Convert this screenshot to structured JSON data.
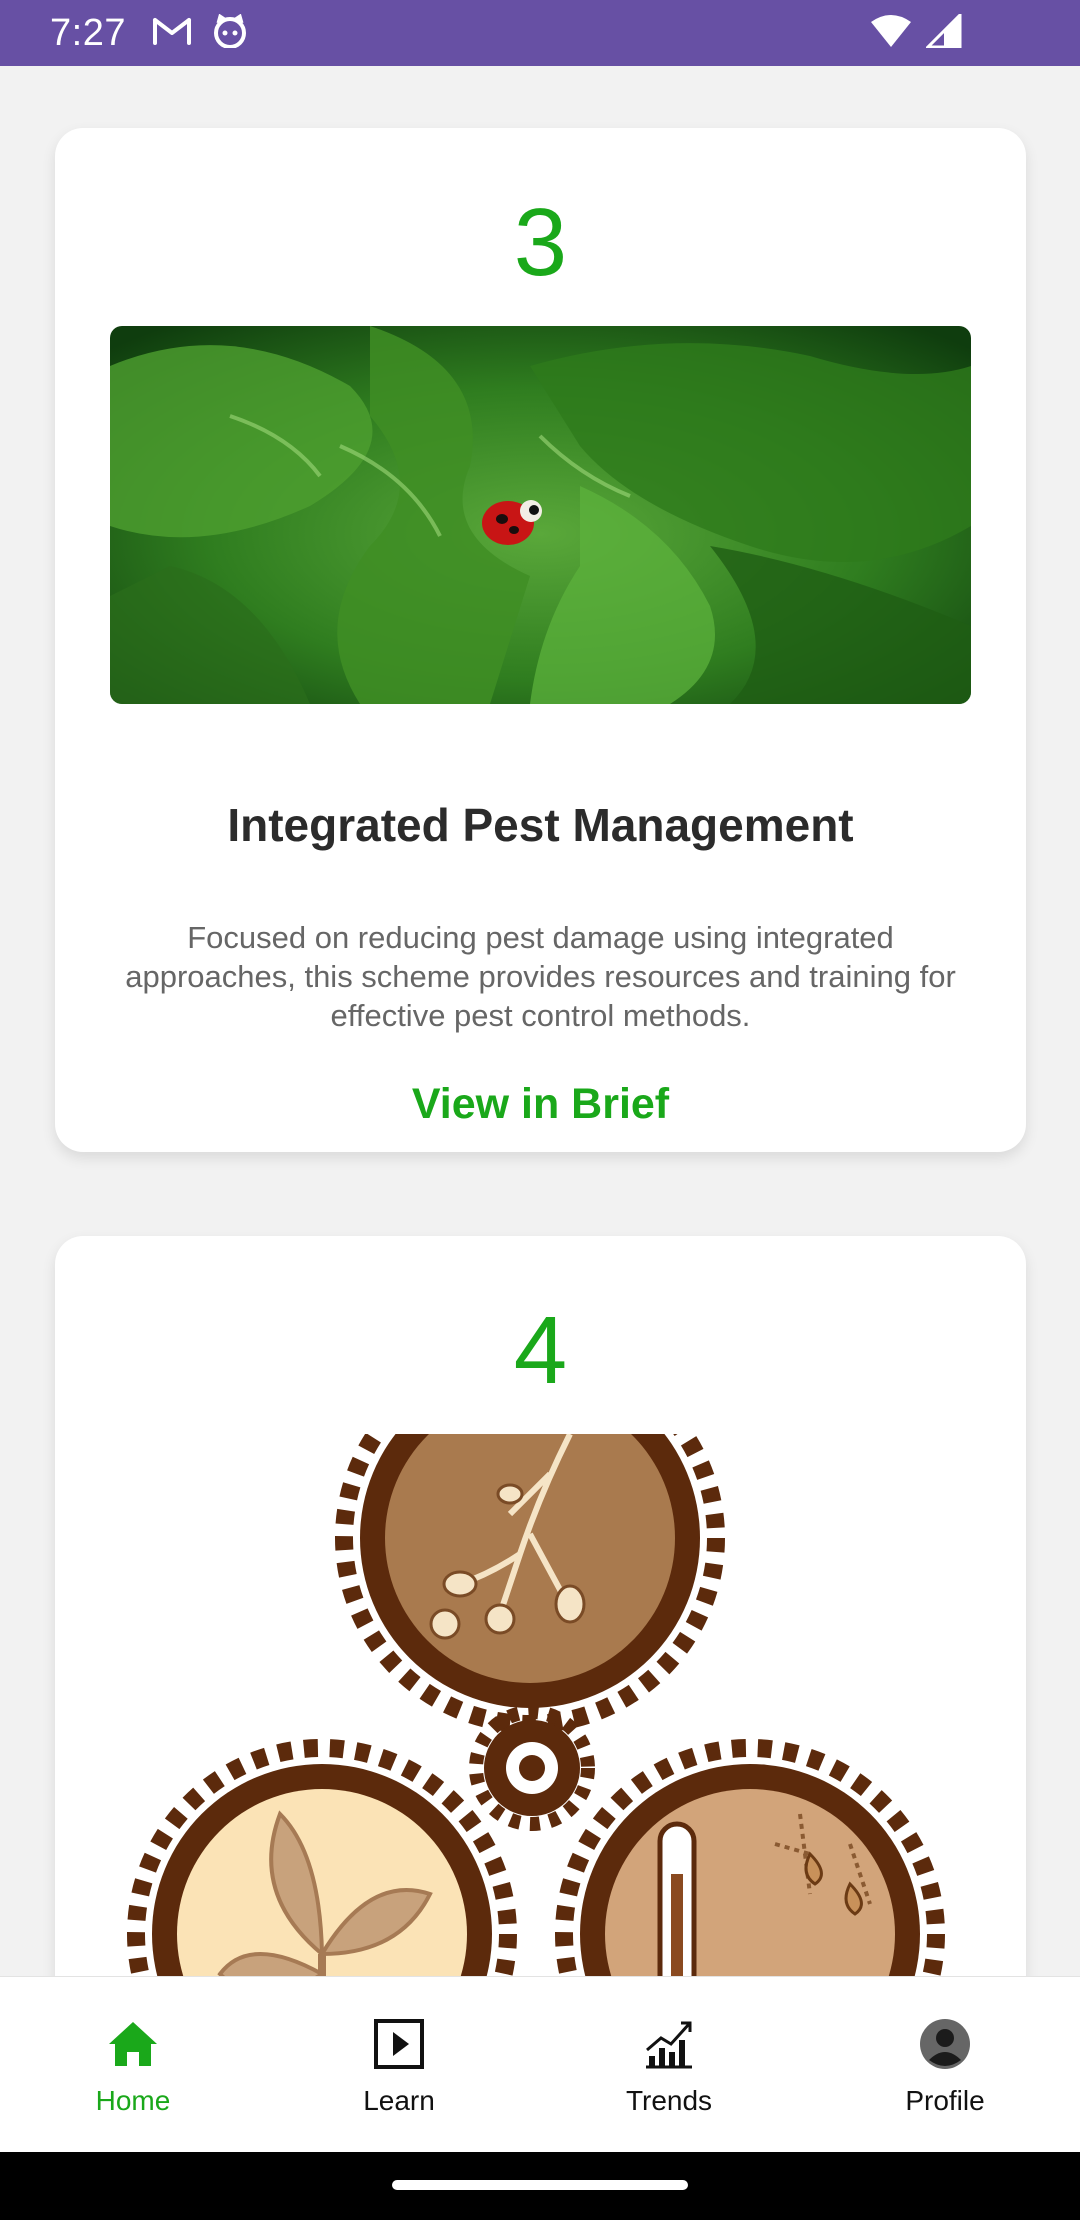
{
  "status_bar": {
    "time": "7:27",
    "icons": [
      "gmail-icon",
      "cat-face-icon",
      "wifi-icon",
      "signal-icon"
    ],
    "color": "#6750a4"
  },
  "cards": [
    {
      "number": "3",
      "image": "ladybug-on-lettuce-image",
      "title": "Integrated Pest Management",
      "description": "Focused on reducing pest damage using integrated approaches, this scheme provides resources and training for effective pest control methods.",
      "link_label": "View in Brief"
    },
    {
      "number": "4",
      "image": "soil-plant-weather-gears-image"
    }
  ],
  "accent_color": "#1aa81a",
  "bottom_nav": {
    "items": [
      {
        "label": "Home",
        "icon": "home-icon",
        "active": true
      },
      {
        "label": "Learn",
        "icon": "play-icon",
        "active": false
      },
      {
        "label": "Trends",
        "icon": "trend-chart-icon",
        "active": false
      },
      {
        "label": "Profile",
        "icon": "account-icon",
        "active": false
      }
    ]
  }
}
